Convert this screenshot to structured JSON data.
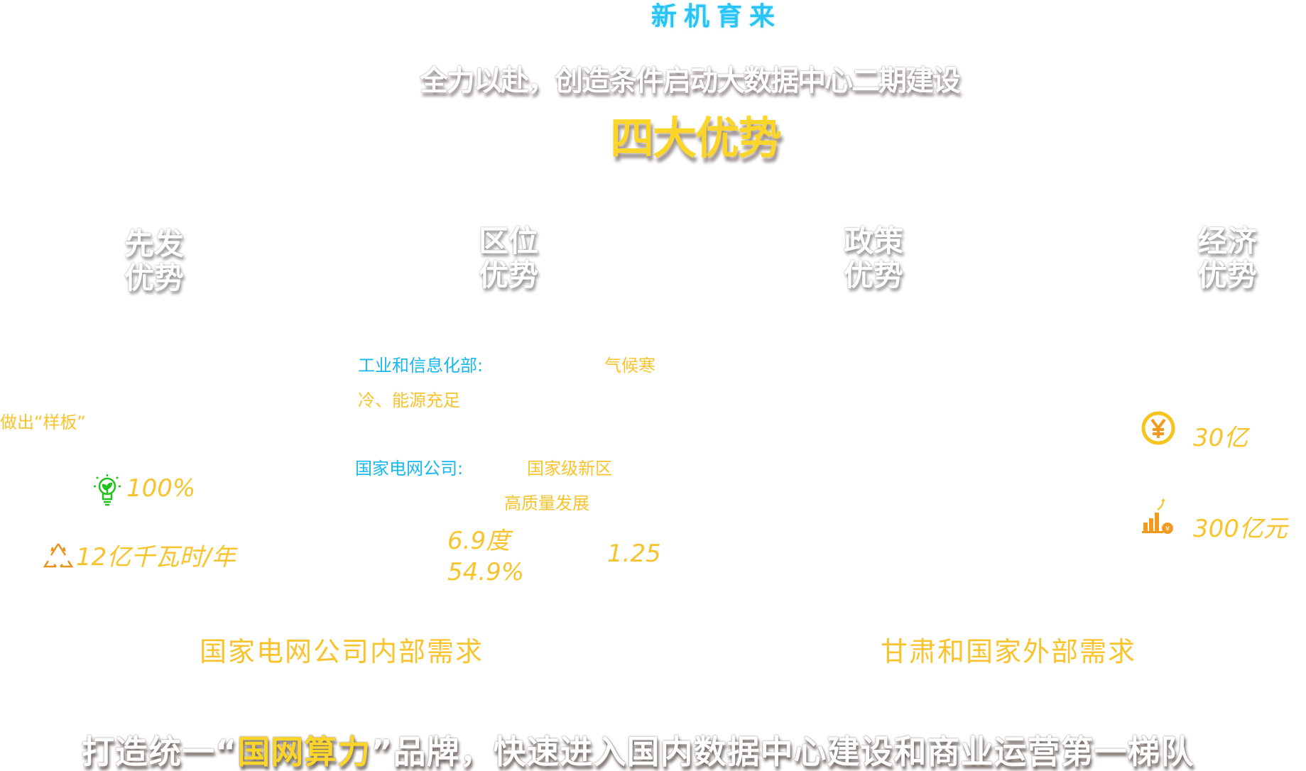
{
  "kicker": "新机育来",
  "headline": "全力以赴，创造条件启动大数据中心二期建设",
  "section_title": "四大优势",
  "advantages": [
    {
      "line1": "先发",
      "line2": "优势"
    },
    {
      "line1": "区位",
      "line2": "优势"
    },
    {
      "line1": "政策",
      "line2": "优势"
    },
    {
      "line1": "经济",
      "line2": "优势"
    }
  ],
  "first_mover": {
    "note": "做出“样板”",
    "green_energy": "100%",
    "energy_saving": "12亿千瓦时/年"
  },
  "location": {
    "miit_label": "工业和信息化部:",
    "miit_value_1": "气候寒",
    "miit_value_2": "冷、能源充足",
    "sgcc_label": "国家电网公司:",
    "sgcc_value_1": "国家级新区",
    "sgcc_value_2": "高质量发展",
    "price": "6.9度",
    "ratio": "54.9%",
    "pue": "1.25"
  },
  "economy": {
    "investment": "30亿",
    "output": "300亿元"
  },
  "needs": {
    "internal": "国家电网公司内部需求",
    "external": "甘肃和国家外部需求"
  },
  "slogan": {
    "prefix": "打造统一“",
    "brand": "国网算力",
    "suffix": "”品牌，快速进入国内数据中心建设和商业运营第一梯队"
  },
  "colors": {
    "yellow": "#fbd52a",
    "blue": "#17b8f2",
    "green": "#22c21e",
    "orange": "#f29a1f"
  }
}
